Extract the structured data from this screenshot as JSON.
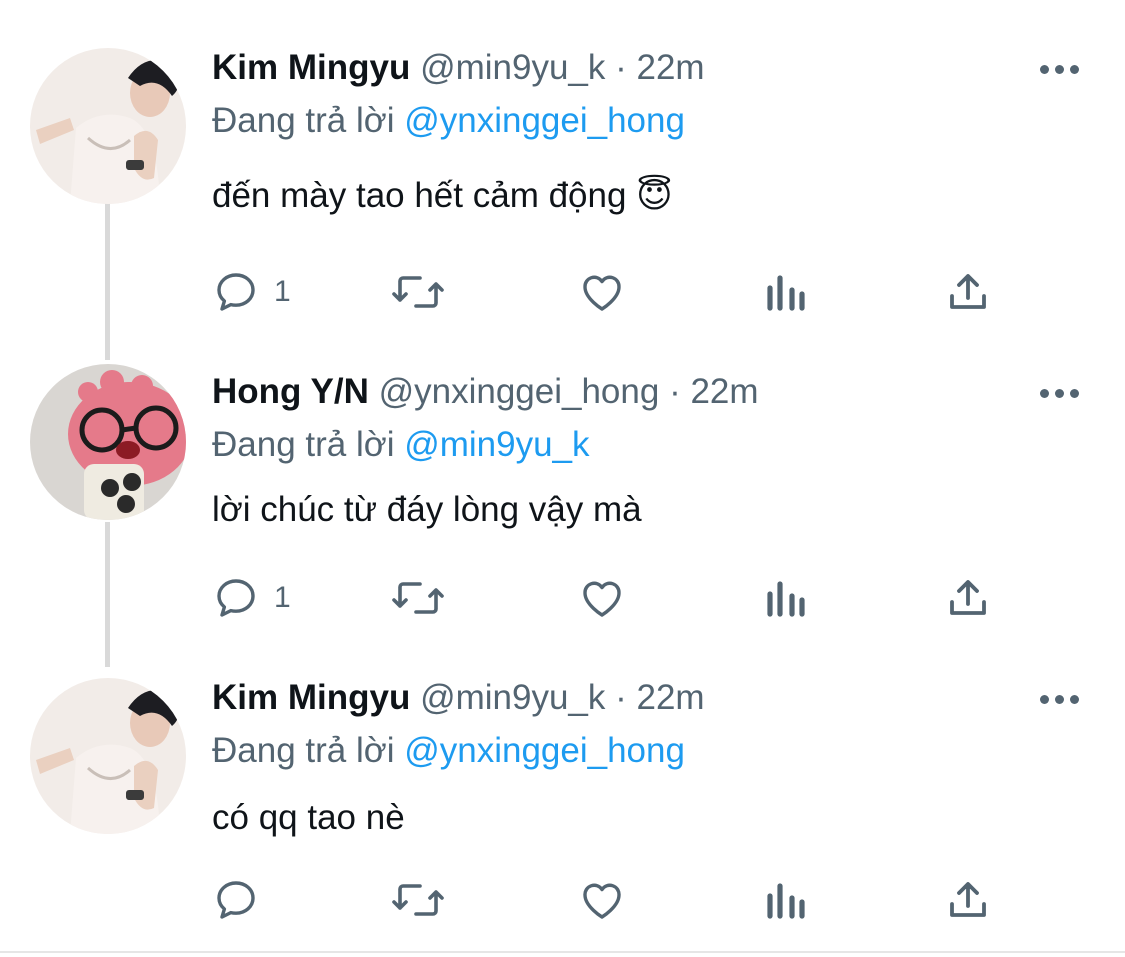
{
  "tweets": [
    {
      "name": "Kim Mingyu",
      "handle": "@min9yu_k",
      "time": "· 22m",
      "reply_prefix": "Đang trả lời",
      "reply_to": "@ynxinggei_hong",
      "text": "đến mày tao hết cảm động",
      "emoji": "😇",
      "reply_count": "1",
      "avatar": "avatar-kim-mingyu"
    },
    {
      "name": "Hong Y/N",
      "handle": "@ynxinggei_hong",
      "time": "· 22m",
      "reply_prefix": "Đang trả lời",
      "reply_to": "@min9yu_k",
      "text": "lời chúc từ đáy lòng vậy mà",
      "reply_count": "1",
      "avatar": "avatar-hong-yn"
    },
    {
      "name": "Kim Mingyu",
      "handle": "@min9yu_k",
      "time": "· 22m",
      "reply_prefix": "Đang trả lời",
      "reply_to": "@ynxinggei_hong",
      "text": "có qq tao nè",
      "reply_count": "",
      "avatar": "avatar-kim-mingyu"
    }
  ],
  "icons": {
    "reply": "reply-bubble-icon",
    "retweet": "retweet-icon",
    "like": "heart-icon",
    "views": "analytics-bars-icon",
    "share": "share-upload-icon",
    "more": "more-dots-icon"
  },
  "colors": {
    "text": "#0f1419",
    "secondary": "#536471",
    "mention": "#1d9bf0",
    "thread_line": "#d9d9d9"
  }
}
